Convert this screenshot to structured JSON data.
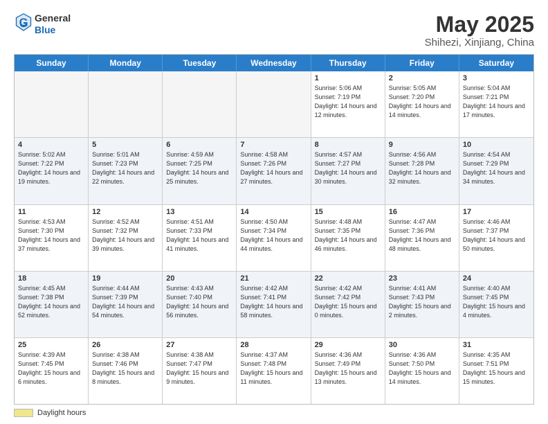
{
  "logo": {
    "line1": "General",
    "line2": "Blue"
  },
  "title": {
    "month_year": "May 2025",
    "location": "Shihezi, Xinjiang, China"
  },
  "days_of_week": [
    "Sunday",
    "Monday",
    "Tuesday",
    "Wednesday",
    "Thursday",
    "Friday",
    "Saturday"
  ],
  "footer": {
    "label": "Daylight hours"
  },
  "weeks": [
    [
      {
        "day": "",
        "info": ""
      },
      {
        "day": "",
        "info": ""
      },
      {
        "day": "",
        "info": ""
      },
      {
        "day": "",
        "info": ""
      },
      {
        "day": "1",
        "info": "Sunrise: 5:06 AM\nSunset: 7:19 PM\nDaylight: 14 hours and 12 minutes."
      },
      {
        "day": "2",
        "info": "Sunrise: 5:05 AM\nSunset: 7:20 PM\nDaylight: 14 hours and 14 minutes."
      },
      {
        "day": "3",
        "info": "Sunrise: 5:04 AM\nSunset: 7:21 PM\nDaylight: 14 hours and 17 minutes."
      }
    ],
    [
      {
        "day": "4",
        "info": "Sunrise: 5:02 AM\nSunset: 7:22 PM\nDaylight: 14 hours and 19 minutes."
      },
      {
        "day": "5",
        "info": "Sunrise: 5:01 AM\nSunset: 7:23 PM\nDaylight: 14 hours and 22 minutes."
      },
      {
        "day": "6",
        "info": "Sunrise: 4:59 AM\nSunset: 7:25 PM\nDaylight: 14 hours and 25 minutes."
      },
      {
        "day": "7",
        "info": "Sunrise: 4:58 AM\nSunset: 7:26 PM\nDaylight: 14 hours and 27 minutes."
      },
      {
        "day": "8",
        "info": "Sunrise: 4:57 AM\nSunset: 7:27 PM\nDaylight: 14 hours and 30 minutes."
      },
      {
        "day": "9",
        "info": "Sunrise: 4:56 AM\nSunset: 7:28 PM\nDaylight: 14 hours and 32 minutes."
      },
      {
        "day": "10",
        "info": "Sunrise: 4:54 AM\nSunset: 7:29 PM\nDaylight: 14 hours and 34 minutes."
      }
    ],
    [
      {
        "day": "11",
        "info": "Sunrise: 4:53 AM\nSunset: 7:30 PM\nDaylight: 14 hours and 37 minutes."
      },
      {
        "day": "12",
        "info": "Sunrise: 4:52 AM\nSunset: 7:32 PM\nDaylight: 14 hours and 39 minutes."
      },
      {
        "day": "13",
        "info": "Sunrise: 4:51 AM\nSunset: 7:33 PM\nDaylight: 14 hours and 41 minutes."
      },
      {
        "day": "14",
        "info": "Sunrise: 4:50 AM\nSunset: 7:34 PM\nDaylight: 14 hours and 44 minutes."
      },
      {
        "day": "15",
        "info": "Sunrise: 4:48 AM\nSunset: 7:35 PM\nDaylight: 14 hours and 46 minutes."
      },
      {
        "day": "16",
        "info": "Sunrise: 4:47 AM\nSunset: 7:36 PM\nDaylight: 14 hours and 48 minutes."
      },
      {
        "day": "17",
        "info": "Sunrise: 4:46 AM\nSunset: 7:37 PM\nDaylight: 14 hours and 50 minutes."
      }
    ],
    [
      {
        "day": "18",
        "info": "Sunrise: 4:45 AM\nSunset: 7:38 PM\nDaylight: 14 hours and 52 minutes."
      },
      {
        "day": "19",
        "info": "Sunrise: 4:44 AM\nSunset: 7:39 PM\nDaylight: 14 hours and 54 minutes."
      },
      {
        "day": "20",
        "info": "Sunrise: 4:43 AM\nSunset: 7:40 PM\nDaylight: 14 hours and 56 minutes."
      },
      {
        "day": "21",
        "info": "Sunrise: 4:42 AM\nSunset: 7:41 PM\nDaylight: 14 hours and 58 minutes."
      },
      {
        "day": "22",
        "info": "Sunrise: 4:42 AM\nSunset: 7:42 PM\nDaylight: 15 hours and 0 minutes."
      },
      {
        "day": "23",
        "info": "Sunrise: 4:41 AM\nSunset: 7:43 PM\nDaylight: 15 hours and 2 minutes."
      },
      {
        "day": "24",
        "info": "Sunrise: 4:40 AM\nSunset: 7:45 PM\nDaylight: 15 hours and 4 minutes."
      }
    ],
    [
      {
        "day": "25",
        "info": "Sunrise: 4:39 AM\nSunset: 7:45 PM\nDaylight: 15 hours and 6 minutes."
      },
      {
        "day": "26",
        "info": "Sunrise: 4:38 AM\nSunset: 7:46 PM\nDaylight: 15 hours and 8 minutes."
      },
      {
        "day": "27",
        "info": "Sunrise: 4:38 AM\nSunset: 7:47 PM\nDaylight: 15 hours and 9 minutes."
      },
      {
        "day": "28",
        "info": "Sunrise: 4:37 AM\nSunset: 7:48 PM\nDaylight: 15 hours and 11 minutes."
      },
      {
        "day": "29",
        "info": "Sunrise: 4:36 AM\nSunset: 7:49 PM\nDaylight: 15 hours and 13 minutes."
      },
      {
        "day": "30",
        "info": "Sunrise: 4:36 AM\nSunset: 7:50 PM\nDaylight: 15 hours and 14 minutes."
      },
      {
        "day": "31",
        "info": "Sunrise: 4:35 AM\nSunset: 7:51 PM\nDaylight: 15 hours and 15 minutes."
      }
    ]
  ]
}
